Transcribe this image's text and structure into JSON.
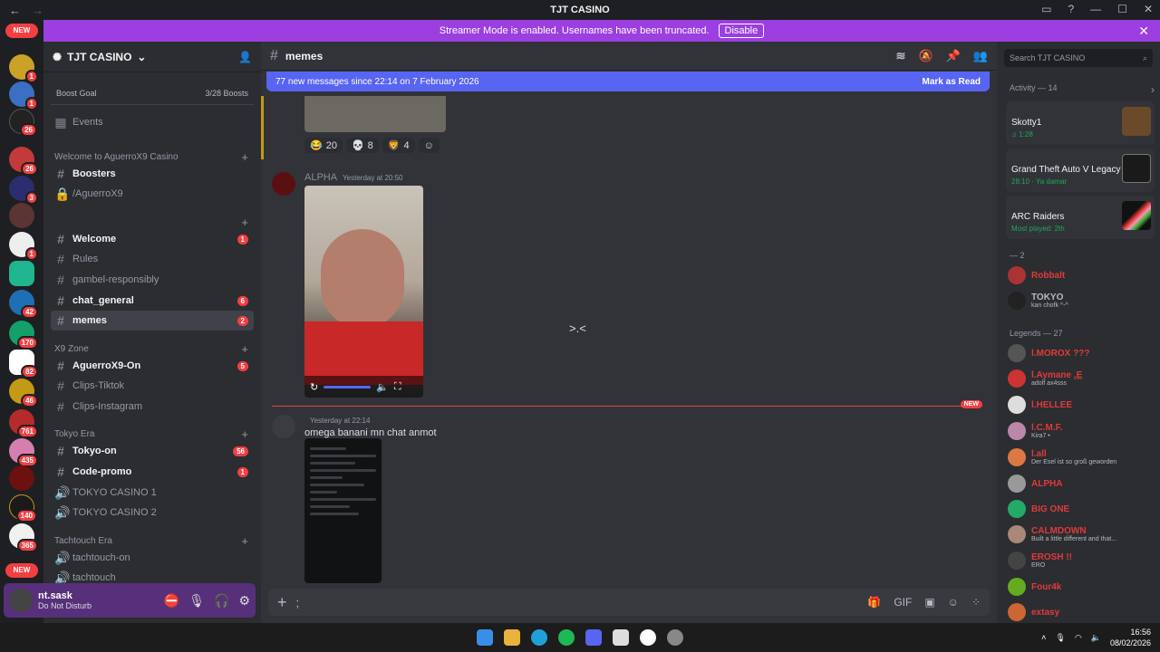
{
  "titlebar": {
    "title": "TJT CASINO"
  },
  "banner": {
    "text": "Streamer Mode is enabled. Usernames have been truncated.",
    "button": "Disable"
  },
  "servers": {
    "new_top": "NEW",
    "new_bottom": "NEW",
    "badges": [
      "1",
      "1",
      "26",
      "26",
      "3",
      "",
      "1",
      "",
      "42",
      "170",
      "82",
      "46",
      "761",
      "435",
      "",
      "140",
      "365"
    ]
  },
  "guild": {
    "name": "TJT CASINO"
  },
  "boost": {
    "label": "Boost Goal",
    "progress": "3/28 Boosts"
  },
  "events": "Events",
  "categories": {
    "welcome": "Welcome to AguerroX9 Casino",
    "empty": "",
    "x9": "X9 Zone",
    "tokyo": "Tokyo Era",
    "tachtouch": "Tachtouch Era"
  },
  "channels": {
    "boosters": "Boosters",
    "aguerro": "/AguerroX9",
    "welcome": "Welcome",
    "welcome_cnt": "1",
    "rules": "Rules",
    "gambel": "gambel-responsibly",
    "chat_general": "chat_general",
    "chat_general_cnt": "6",
    "memes": "memes",
    "memes_cnt": "2",
    "aguerro_on": "AguerroX9-On",
    "aguerro_on_cnt": "5",
    "clips_tiktok": "Clips-Tiktok",
    "clips_insta": "Clips-Instagram",
    "tokyo_on": "Tokyo-on",
    "tokyo_on_cnt": "56",
    "code_promo": "Code-promo",
    "code_promo_cnt": "1",
    "tokyo_casino1": "TOKYO CASINO 1",
    "tokyo_casino2": "TOKYO CASINO 2",
    "tachtouch_on": "tachtouch-on",
    "tachtouch": "tachtouch"
  },
  "user": {
    "name": "nt.sask",
    "status": "Do Not Disturb"
  },
  "chat": {
    "channel": "memes",
    "new_messages": "77 new messages since 22:14 on 7 February 2026",
    "mark_read": "Mark as Read",
    "reactions": [
      {
        "emoji": "😂",
        "count": "20"
      },
      {
        "emoji": "💀",
        "count": "8"
      },
      {
        "emoji": "🦁",
        "count": "4"
      }
    ],
    "msg1_author": "ALPHA",
    "msg1_time": "Yesterday at 20:50",
    "msg2_author": "",
    "msg2_time": "Yesterday at 22:14",
    "msg2_text": "omega banani mn chat anmot",
    "new_label": "NEW",
    "emote": ">.<",
    "composer_text": ";"
  },
  "members": {
    "search_placeholder": "Search TJT CASINO",
    "activity_header": "Activity — 14",
    "activities": [
      {
        "user": "",
        "title": "Skotty1",
        "sub": "♫ 1:28"
      },
      {
        "user": "",
        "title": "Grand Theft Auto V Legacy",
        "sub": "28:10 · Ya damar"
      },
      {
        "user": "",
        "title": "ARC Raiders",
        "sub": "Most played: 2th"
      }
    ],
    "group1": "— 2",
    "group1_members": [
      {
        "name": "Robbalt",
        "sub": "",
        "color": "#e03a3a"
      },
      {
        "name": "TOKYO",
        "sub": "kan chofk ^-^",
        "color": "#b5bac1"
      }
    ],
    "group2": "Legends — 27",
    "group2_members": [
      {
        "name": "l.MOROX ??? ",
        "sub": "",
        "color": "#e03a3a"
      },
      {
        "name": "l.Aymane .̲͟E",
        "sub": "adolf ax4sss",
        "color": "#e03a3a"
      },
      {
        "name": "l.HELLEE",
        "sub": "",
        "color": "#e03a3a"
      },
      {
        "name": "l.C.M.F.",
        "sub": "Kira7 •",
        "color": "#e03a3a"
      },
      {
        "name": "l.all",
        "sub": "Der Esel ist so groß geworden",
        "color": "#e03a3a"
      },
      {
        "name": "ALPHA",
        "sub": "",
        "color": "#e03a3a"
      },
      {
        "name": "BIG ONE",
        "sub": "",
        "color": "#e03a3a"
      },
      {
        "name": "CALMDOWN",
        "sub": "Built a little different and that...",
        "color": "#e03a3a"
      },
      {
        "name": "EROSH !!",
        "sub": "ERO",
        "color": "#e03a3a"
      },
      {
        "name": "Four4k",
        "sub": "",
        "color": "#e03a3a"
      },
      {
        "name": "extasy",
        "sub": "",
        "color": "#e03a3a"
      }
    ]
  },
  "taskbar": {
    "time": "16:56",
    "date": "08/02/2026"
  }
}
